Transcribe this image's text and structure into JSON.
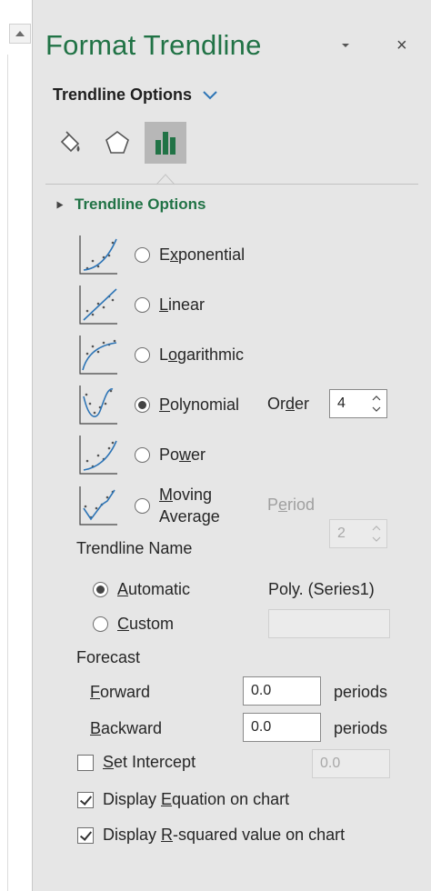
{
  "pane": {
    "title": "Format Trendline",
    "close_glyph": "×"
  },
  "options_dropdown": {
    "label": "Trendline Options"
  },
  "tabs": [
    {
      "name": "fill-line-icon"
    },
    {
      "name": "effects-icon"
    },
    {
      "name": "bar-chart-icon",
      "selected": true
    }
  ],
  "section": {
    "header": "Trendline Options"
  },
  "trend_types": [
    {
      "label_pre": "E",
      "label_u": "x",
      "label_post": "ponential",
      "selected": false
    },
    {
      "label_pre": "",
      "label_u": "L",
      "label_post": "inear",
      "selected": false
    },
    {
      "label_pre": "L",
      "label_u": "o",
      "label_post": "garithmic",
      "selected": false
    },
    {
      "label_pre": "",
      "label_u": "P",
      "label_post": "olynomial",
      "selected": true
    },
    {
      "label_pre": "Po",
      "label_u": "w",
      "label_post": "er",
      "selected": false
    },
    {
      "label_pre": "",
      "label_u": "M",
      "label_post": "oving",
      "label_line2": "Average",
      "selected": false
    }
  ],
  "order": {
    "label_pre": "Or",
    "label_u": "d",
    "label_post": "er",
    "value": "4"
  },
  "period": {
    "label_pre": "P",
    "label_u": "e",
    "label_post": "riod",
    "value": "2"
  },
  "trendline_name": {
    "label": "Trendline Name",
    "automatic_u": "A",
    "automatic_post": "utomatic",
    "custom_u": "C",
    "custom_post": "ustom",
    "auto_value": "Poly. (Series1)",
    "custom_value": "",
    "selected": "automatic"
  },
  "forecast": {
    "label": "Forecast",
    "forward_u": "F",
    "forward_post": "orward",
    "forward_value": "0.0",
    "backward_u": "B",
    "backward_post": "ackward",
    "backward_value": "0.0",
    "unit": "periods"
  },
  "intercept": {
    "label_u": "S",
    "label_post": "et Intercept",
    "value": "0.0",
    "checked": false
  },
  "display_equation": {
    "label_pre": "Display ",
    "label_u": "E",
    "label_post": "quation on chart",
    "checked": true
  },
  "display_rsquared": {
    "label_pre": "Display ",
    "label_u": "R",
    "label_post": "-squared value on chart",
    "checked": true
  },
  "colors": {
    "accent_green": "#217346",
    "curve_blue": "#2e75b6",
    "pane_bg": "#e6e6e6"
  }
}
